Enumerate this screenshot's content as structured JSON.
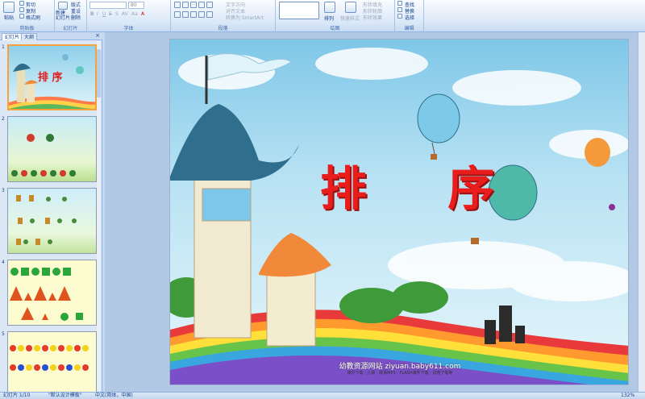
{
  "ribbon": {
    "clipboard": {
      "label": "剪贴板",
      "paste": "粘贴",
      "cut": "剪切",
      "copy": "复制",
      "format_painter": "格式刷"
    },
    "slides": {
      "label": "幻灯片",
      "new_slide": "新建\n幻灯片",
      "layout": "版式",
      "reset": "重设",
      "delete": "删除"
    },
    "font": {
      "label": "字体",
      "font_name": "",
      "font_size": "80",
      "bold": "B",
      "italic": "I",
      "underline": "U",
      "strike": "S",
      "shadow": "S",
      "spacing": "AV",
      "case": "Aa",
      "color": "A"
    },
    "paragraph": {
      "label": "段落",
      "text_direction": "文字方向",
      "align_text": "对齐文本",
      "smartart": "转换为 SmartArt"
    },
    "drawing": {
      "label": "绘图",
      "arrange": "排列",
      "quick_styles": "快速样式",
      "shape_fill": "形状填充",
      "shape_outline": "形状轮廓",
      "shape_effects": "形状效果"
    },
    "editing": {
      "label": "编辑",
      "find": "查找",
      "replace": "替换",
      "select": "选择"
    }
  },
  "panel": {
    "tab_slides": "幻灯片",
    "tab_outline": "大纲",
    "close": "×",
    "items": [
      {
        "num": "1",
        "mini_title": "排 序"
      },
      {
        "num": "2"
      },
      {
        "num": "3"
      },
      {
        "num": "4"
      },
      {
        "num": "5"
      }
    ]
  },
  "slide": {
    "title": "排 序",
    "footer_site": "幼教资源网站  ziyuan.baby611.com",
    "footer_sub": "课件下载 · 儿歌 · 故事MP3 · FLASH课件下载 · 试卷下载等"
  },
  "status": {
    "slide_info": "幻灯片 1/10",
    "theme": "\"默认设计模板\"",
    "language": "中文(简体，中国)",
    "zoom": "132%"
  },
  "colors": {
    "title_red": "#ea1d1d",
    "selection_orange": "#f4a23c",
    "ribbon_blue": "#dbe8f7"
  }
}
